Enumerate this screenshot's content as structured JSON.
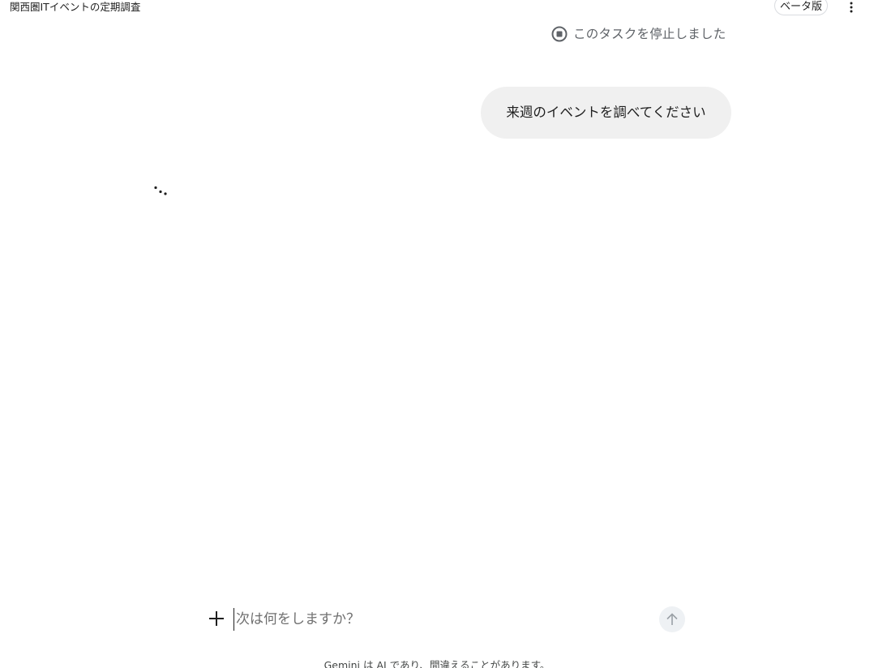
{
  "header": {
    "chat_title": "関西圏ITイベントの定期調査",
    "beta_label": "ベータ版",
    "more_icon": "more-vert-icon"
  },
  "conversation": {
    "stopped_notice": {
      "icon": "stop-circle-icon",
      "text": "このタスクを停止しました"
    },
    "user_message": "来週のイベントを調べてください",
    "loading_icon": "thinking-dots-icon"
  },
  "composer": {
    "add_icon": "plus-icon",
    "placeholder": "次は何をしますか？",
    "value": "",
    "send_icon": "arrow-up-icon"
  },
  "footer": {
    "disclaimer": "Gemini は AI であり、間違えることがあります。"
  },
  "colors": {
    "bubble_background": "#f0f0f0",
    "muted_text": "#5f6368",
    "send_button_background": "#eef1f4"
  }
}
